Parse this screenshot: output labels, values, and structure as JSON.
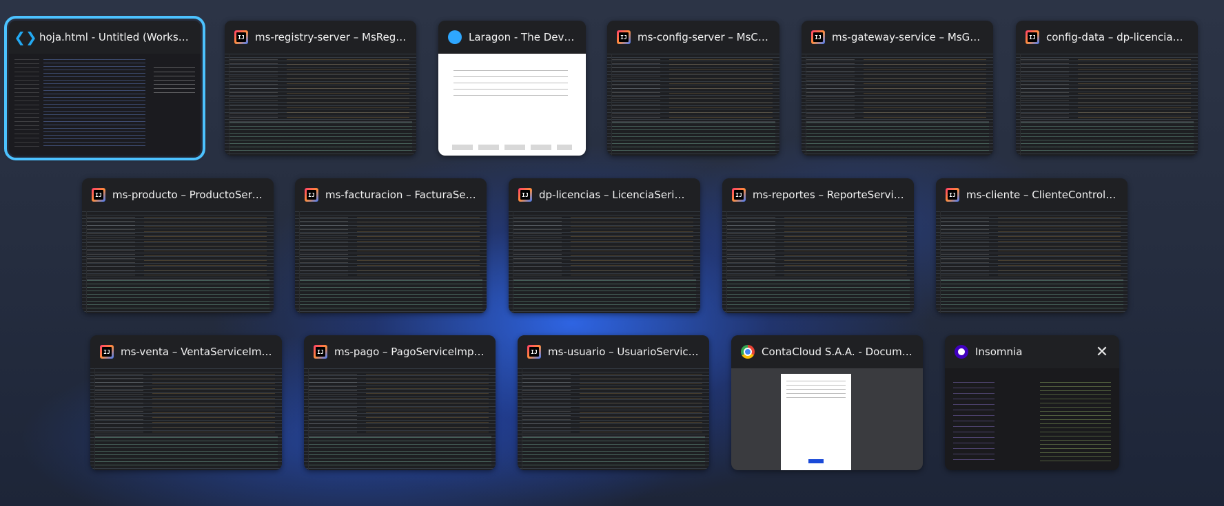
{
  "windows": [
    {
      "title": "hoja.html - Untitled (Workspac...",
      "icon": "vscode-icon"
    },
    {
      "title": "ms-registry-server – MsRegistr...",
      "icon": "intellij-icon"
    },
    {
      "title": "Laragon - The Dev E...",
      "icon": "laragon-icon"
    },
    {
      "title": "ms-config-server – MsCon...",
      "icon": "intellij-icon"
    },
    {
      "title": "ms-gateway-service – MsGate...",
      "icon": "intellij-icon"
    },
    {
      "title": "config-data – dp-licencias.yml",
      "icon": "intellij-icon"
    },
    {
      "title": "ms-producto – ProductoServic...",
      "icon": "intellij-icon"
    },
    {
      "title": "ms-facturacion – FacturaServic...",
      "icon": "intellij-icon"
    },
    {
      "title": "dp-licencias – LicenciaSeriveIm...",
      "icon": "intellij-icon"
    },
    {
      "title": "ms-reportes – ReporteServiceI...",
      "icon": "intellij-icon"
    },
    {
      "title": "ms-cliente – ClienteController.j...",
      "icon": "intellij-icon"
    },
    {
      "title": "ms-venta – VentaServiceImpl.j...",
      "icon": "intellij-icon"
    },
    {
      "title": "ms-pago – PagoServiceImpl.java",
      "icon": "intellij-icon"
    },
    {
      "title": "ms-usuario – UsuarioServiceIm...",
      "icon": "intellij-icon"
    },
    {
      "title": "ContaCloud S.A.A. - Document...",
      "icon": "chrome-icon"
    },
    {
      "title": "Insomnia",
      "icon": "insomnia-icon"
    }
  ],
  "close_glyph": "✕",
  "intellij_glyph": "IJ",
  "colors": {
    "selection": "#4cc2ff",
    "card": "#1f2023"
  }
}
